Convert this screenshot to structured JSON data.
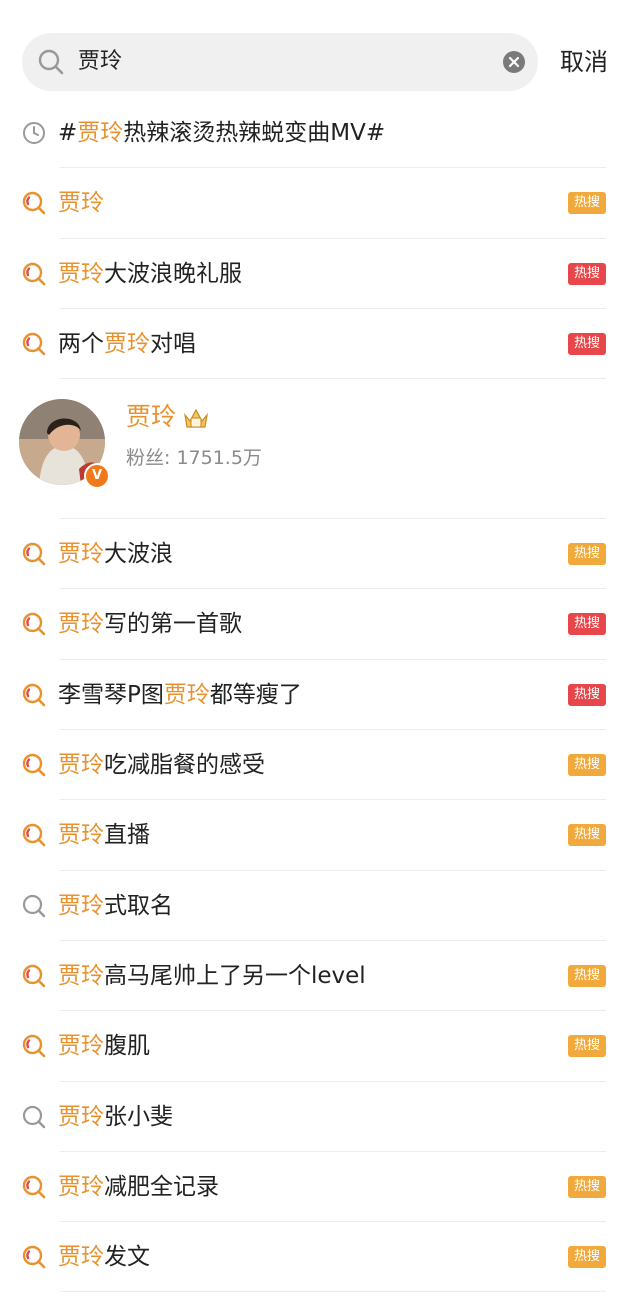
{
  "search": {
    "query": "贾玲",
    "cancel_label": "取消"
  },
  "history_item": {
    "prefix": "#",
    "highlight": "贾玲",
    "text": "热辣滚烫热辣蜕变曲MV#"
  },
  "suggestions_top": [
    {
      "pre": "",
      "highlight": "贾玲",
      "post": "",
      "badge": "热搜",
      "badge_color": "orange",
      "icon": "hot-search-icon"
    },
    {
      "pre": "",
      "highlight": "贾玲",
      "post": "大波浪晚礼服",
      "badge": "热搜",
      "badge_color": "red",
      "icon": "hot-search-icon"
    },
    {
      "pre": "两个",
      "highlight": "贾玲",
      "post": "对唱",
      "badge": "热搜",
      "badge_color": "red",
      "icon": "hot-search-icon"
    }
  ],
  "profile": {
    "name": "贾玲",
    "fans": "粉丝: 1751.5万",
    "verified_mark": "V"
  },
  "suggestions_bottom": [
    {
      "pre": "",
      "highlight": "贾玲",
      "post": "大波浪",
      "badge": "热搜",
      "badge_color": "orange",
      "icon": "hot-search-icon"
    },
    {
      "pre": "",
      "highlight": "贾玲",
      "post": "写的第一首歌",
      "badge": "热搜",
      "badge_color": "red",
      "icon": "hot-search-icon"
    },
    {
      "pre": "李雪琴P图",
      "highlight": "贾玲",
      "post": "都等瘦了",
      "badge": "热搜",
      "badge_color": "red",
      "icon": "hot-search-icon"
    },
    {
      "pre": "",
      "highlight": "贾玲",
      "post": "吃减脂餐的感受",
      "badge": "热搜",
      "badge_color": "orange",
      "icon": "hot-search-icon"
    },
    {
      "pre": "",
      "highlight": "贾玲",
      "post": "直播",
      "badge": "热搜",
      "badge_color": "orange",
      "icon": "hot-search-icon"
    },
    {
      "pre": "",
      "highlight": "贾玲",
      "post": "式取名",
      "badge": "",
      "badge_color": "",
      "icon": "search-icon"
    },
    {
      "pre": "",
      "highlight": "贾玲",
      "post": "高马尾帅上了另一个level",
      "badge": "热搜",
      "badge_color": "orange",
      "icon": "hot-search-icon"
    },
    {
      "pre": "",
      "highlight": "贾玲",
      "post": "腹肌",
      "badge": "热搜",
      "badge_color": "orange",
      "icon": "hot-search-icon"
    },
    {
      "pre": "",
      "highlight": "贾玲",
      "post": "张小斐",
      "badge": "",
      "badge_color": "",
      "icon": "search-icon"
    },
    {
      "pre": "",
      "highlight": "贾玲",
      "post": "减肥全记录",
      "badge": "热搜",
      "badge_color": "orange",
      "icon": "hot-search-icon"
    },
    {
      "pre": "",
      "highlight": "贾玲",
      "post": "发文",
      "badge": "热搜",
      "badge_color": "orange",
      "icon": "hot-search-icon"
    }
  ],
  "colors": {
    "highlight": "#e8912d",
    "badge_orange": "#f2a93b",
    "badge_red": "#e7474a",
    "hot_icon": "#e8912d"
  }
}
